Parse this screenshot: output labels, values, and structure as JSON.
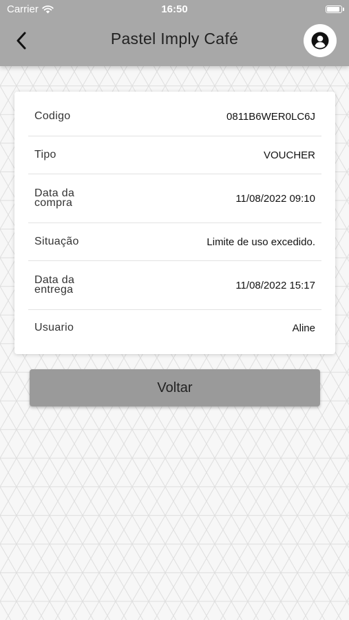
{
  "status_bar": {
    "carrier": "Carrier",
    "time": "16:50",
    "battery_level": 0.95
  },
  "header": {
    "title": "Pastel Imply Café",
    "back_icon": "chevron-left-icon",
    "profile_icon": "user-circle-icon"
  },
  "details": [
    {
      "label": "Codigo",
      "value": "0811B6WER0LC6J"
    },
    {
      "label": "Tipo",
      "value": "VOUCHER"
    },
    {
      "label": "Data da compra",
      "value": "11/08/2022 09:10"
    },
    {
      "label": "Situação",
      "value": "Limite de uso excedido."
    },
    {
      "label": "Data da entrega",
      "value": "11/08/2022 15:17"
    },
    {
      "label": "Usuario",
      "value": "Aline"
    }
  ],
  "button": {
    "voltar_label": "Voltar"
  },
  "colors": {
    "header": "#a8a8a8",
    "button": "#9a9a9a",
    "background": "#f7f7f7"
  }
}
